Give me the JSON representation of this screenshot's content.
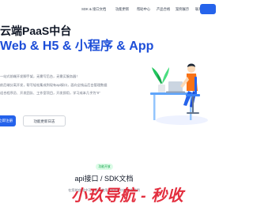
{
  "nav": {
    "items": [
      "SDK & 接口文档",
      "功能更新",
      "帮助中心",
      "产品合格",
      "案例展示",
      "联系我们"
    ]
  },
  "hero": {
    "title": "云端PaaS中台",
    "subtitle": "Web & H5 & 小程序 & App",
    "desc_lines": [
      "一站式前端开发脚手架，无需写后台，无需买服务器！",
      "前后端分离开发，帮写轻松集成到现有api接口，面向全栈云后台管理数据",
      "适合程序员、开发团队、工作室项目，开发即用，学习成本几乎为\"0\""
    ],
    "primary_btn": "立即注册",
    "secondary_btn": "功能更新日志"
  },
  "section": {
    "pill": "功能开放",
    "title": "api接口 / SDK文档",
    "desc": "在您的应用中可以直接使用的API接口与文档说明"
  },
  "watermark": "小玖导航 - 秒收",
  "colors": {
    "brand": "#2563eb",
    "subtitle": "#1d4ed8",
    "pill_bg": "#dcfce7",
    "pill_text": "#16a34a",
    "watermark": "#e11d2e"
  },
  "icons": [
    "person-at-desk-illustration",
    "plant-icon",
    "laptop-icon"
  ]
}
